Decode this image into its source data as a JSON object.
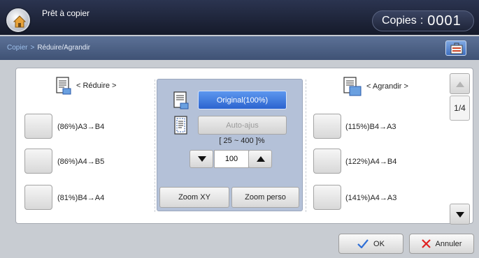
{
  "header": {
    "status_text": "Prêt à copier",
    "copies_label": "Copies",
    "copies_separator": ":",
    "copies_value": "0001"
  },
  "breadcrumb": {
    "parent": "Copier",
    "separator": ">",
    "current": "Réduire/Agrandir"
  },
  "reduce": {
    "heading": "< Réduire >",
    "options": [
      "(86%)A3→B4",
      "(86%)A4→B5",
      "(81%)B4→A4"
    ]
  },
  "enlarge": {
    "heading": "< Agrandir >",
    "options": [
      "(115%)B4→A3",
      "(122%)A4→B4",
      "(141%)A4→A3"
    ]
  },
  "center": {
    "original_label": "Original(100%)",
    "auto_fit_label": "Auto-ajus",
    "range_text": "[ 25 ~ 400 ]%",
    "zoom_value": "100",
    "zoom_xy_label": "Zoom XY",
    "zoom_custom_label": "Zoom perso"
  },
  "pager": {
    "indicator": "1/4"
  },
  "footer": {
    "ok_label": "OK",
    "cancel_label": "Annuler"
  },
  "colors": {
    "selected_blue": "#2c64cf",
    "header_dark": "#151a2a",
    "cancel_red": "#e02020",
    "ok_blue": "#2f6fd6"
  },
  "icons": [
    "home-icon",
    "menu-icon",
    "document-reduce-icon",
    "document-enlarge-icon",
    "original-doc-icon",
    "auto-fit-doc-icon",
    "arrow-down-icon",
    "arrow-up-icon",
    "check-icon",
    "x-icon"
  ]
}
